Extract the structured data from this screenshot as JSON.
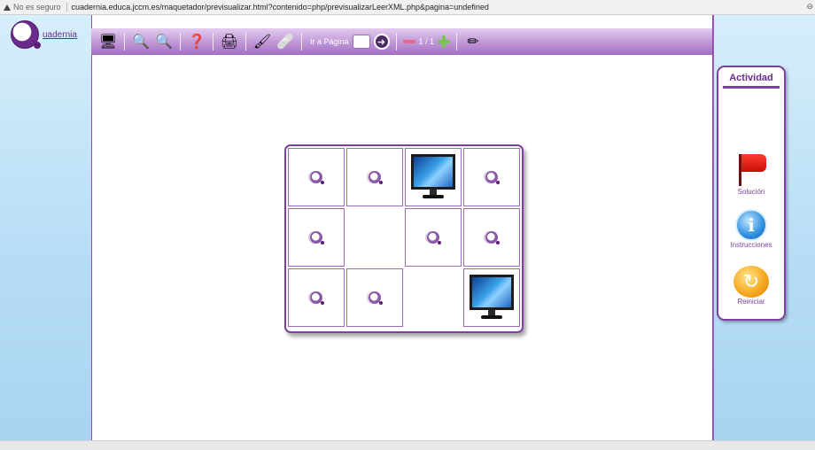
{
  "address_bar": {
    "security_label": "No es seguro",
    "url": "cuadernia.educa.jccm.es/maquetador/previsualizar.html?contenido=php/previsualizarLeerXML.php&pagina=undefined"
  },
  "logo": {
    "text": "uadernia"
  },
  "toolbar": {
    "goto_label": "Ir a Página",
    "page_count": "1 / 1",
    "icons": [
      "monitor-icon",
      "zoom-in-icon",
      "zoom-out-icon",
      "help-icon",
      "print-icon",
      "brush-icon",
      "eraser-icon",
      "go-arrow-icon",
      "minus-icon",
      "plus-icon",
      "edit-icon"
    ]
  },
  "board": {
    "cells": [
      {
        "type": "card"
      },
      {
        "type": "card"
      },
      {
        "type": "monitor"
      },
      {
        "type": "card"
      },
      {
        "type": "card"
      },
      {
        "type": "empty"
      },
      {
        "type": "card"
      },
      {
        "type": "card"
      },
      {
        "type": "card"
      },
      {
        "type": "card"
      },
      {
        "type": "empty"
      },
      {
        "type": "monitor"
      }
    ]
  },
  "activity_panel": {
    "title": "Actividad",
    "buttons": [
      {
        "label": "Solución",
        "icon": "red-flag-icon"
      },
      {
        "label": "Instrucciones",
        "icon": "info-icon"
      },
      {
        "label": "Reiniciar",
        "icon": "reset-arrow-icon"
      }
    ]
  },
  "colors": {
    "accent": "#7d3fa0",
    "side_bg": "#b5dcf5"
  }
}
